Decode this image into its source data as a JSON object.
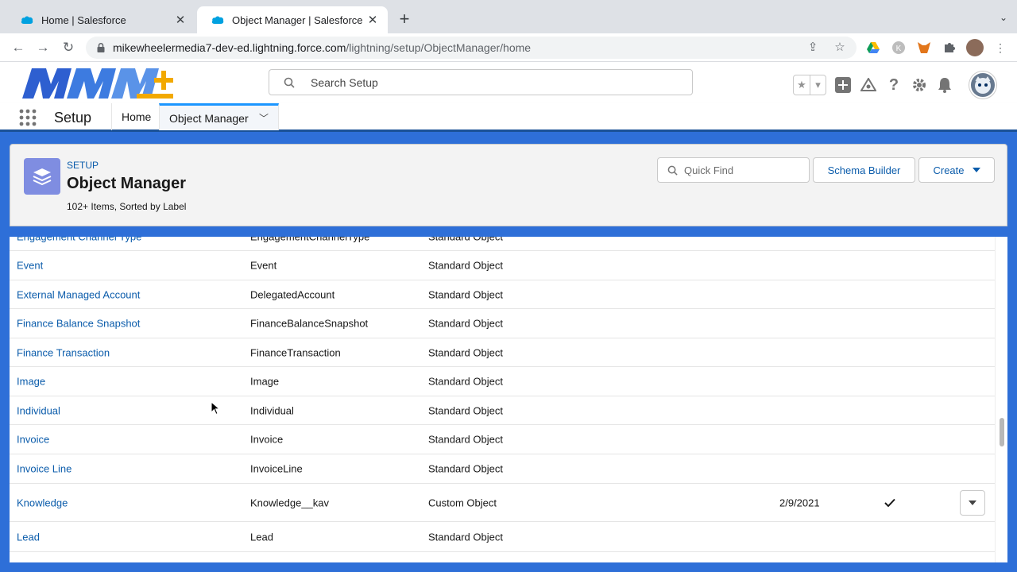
{
  "browser": {
    "tabs": [
      {
        "title": "Home | Salesforce",
        "active": false
      },
      {
        "title": "Object Manager | Salesforce",
        "active": true
      }
    ],
    "url_host": "mikewheelermedia7-dev-ed.lightning.force.com",
    "url_path": "/lightning/setup/ObjectManager/home"
  },
  "header": {
    "search_placeholder": "Search Setup"
  },
  "appnav": {
    "app_name": "Setup",
    "items": [
      {
        "label": "Home"
      },
      {
        "label": "Object Manager"
      }
    ]
  },
  "object_manager": {
    "eyebrow": "SETUP",
    "title": "Object Manager",
    "subtitle": "102+ Items, Sorted by Label",
    "quick_find_placeholder": "Quick Find",
    "schema_builder_label": "Schema Builder",
    "create_label": "Create"
  },
  "table": {
    "rows": [
      {
        "label": "Engagement Channel Type",
        "api": "EngagementChannelType",
        "type": "Standard Object",
        "modified": "",
        "deployed": false
      },
      {
        "label": "Event",
        "api": "Event",
        "type": "Standard Object",
        "modified": "",
        "deployed": false
      },
      {
        "label": "External Managed Account",
        "api": "DelegatedAccount",
        "type": "Standard Object",
        "modified": "",
        "deployed": false
      },
      {
        "label": "Finance Balance Snapshot",
        "api": "FinanceBalanceSnapshot",
        "type": "Standard Object",
        "modified": "",
        "deployed": false
      },
      {
        "label": "Finance Transaction",
        "api": "FinanceTransaction",
        "type": "Standard Object",
        "modified": "",
        "deployed": false
      },
      {
        "label": "Image",
        "api": "Image",
        "type": "Standard Object",
        "modified": "",
        "deployed": false
      },
      {
        "label": "Individual",
        "api": "Individual",
        "type": "Standard Object",
        "modified": "",
        "deployed": false
      },
      {
        "label": "Invoice",
        "api": "Invoice",
        "type": "Standard Object",
        "modified": "",
        "deployed": false
      },
      {
        "label": "Invoice Line",
        "api": "InvoiceLine",
        "type": "Standard Object",
        "modified": "",
        "deployed": false
      },
      {
        "label": "Knowledge",
        "api": "Knowledge__kav",
        "type": "Custom Object",
        "modified": "2/9/2021",
        "deployed": true
      },
      {
        "label": "Lead",
        "api": "Lead",
        "type": "Standard Object",
        "modified": "",
        "deployed": false
      }
    ]
  },
  "colors": {
    "brand_blue": "#2e6fd8",
    "link_blue": "#0b5cab",
    "om_icon": "#7f8de1"
  }
}
